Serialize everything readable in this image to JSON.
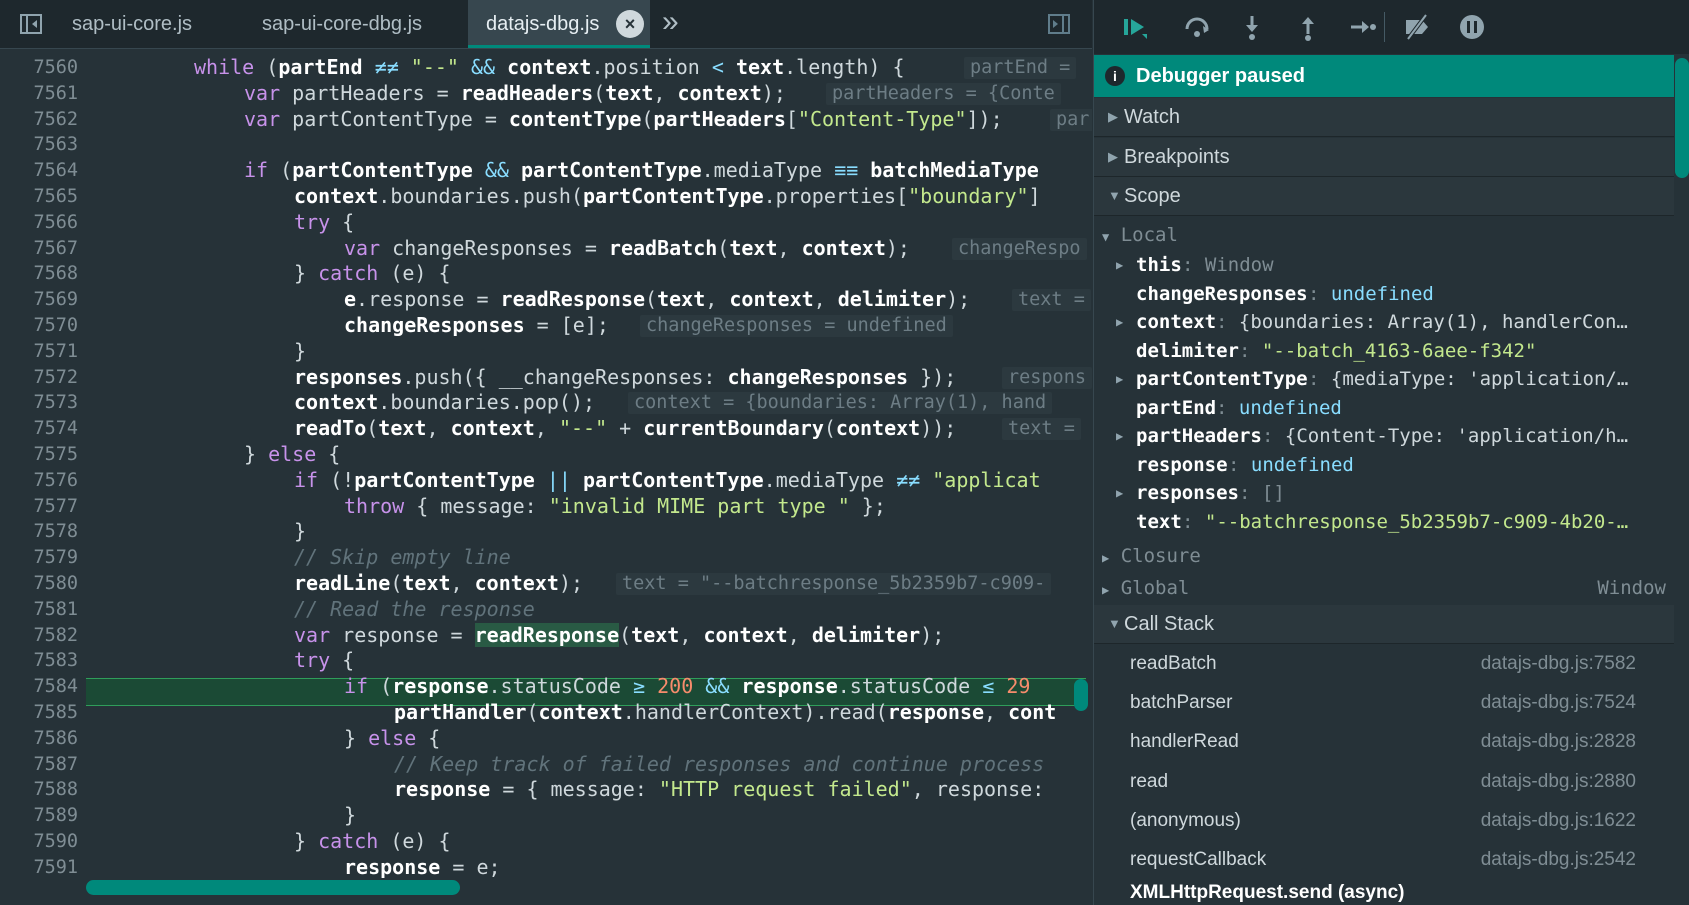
{
  "tabs": [
    "sap-ui-core.js",
    "sap-ui-core-dbg.js",
    "datajs-dbg.js"
  ],
  "active_tab_close": "×",
  "more_tabs": "»",
  "code_lines": [
    {
      "n": "7560"
    },
    {
      "n": "7561"
    },
    {
      "n": "7562"
    },
    {
      "n": "7563"
    },
    {
      "n": "7564"
    },
    {
      "n": "7565"
    },
    {
      "n": "7566"
    },
    {
      "n": "7567"
    },
    {
      "n": "7568"
    },
    {
      "n": "7569"
    },
    {
      "n": "7570"
    },
    {
      "n": "7571"
    },
    {
      "n": "7572"
    },
    {
      "n": "7573"
    },
    {
      "n": "7574"
    },
    {
      "n": "7575"
    },
    {
      "n": "7576"
    },
    {
      "n": "7577"
    },
    {
      "n": "7578"
    },
    {
      "n": "7579"
    },
    {
      "n": "7580"
    },
    {
      "n": "7581"
    },
    {
      "n": "7582"
    },
    {
      "n": "7583"
    },
    {
      "n": "7584"
    },
    {
      "n": "7585"
    },
    {
      "n": "7586"
    },
    {
      "n": "7587"
    },
    {
      "n": "7588"
    },
    {
      "n": "7589"
    },
    {
      "n": "7590"
    },
    {
      "n": "7591"
    }
  ],
  "inline_values": {
    "l7560": "partEnd =",
    "l7561": "partHeaders = {Conte",
    "l7562": "par",
    "l7567": "changeRespo",
    "l7569": "text =",
    "l7570": "changeResponses = undefined",
    "l7572": "respons",
    "l7573": "context = {boundaries: Array(1), hand",
    "l7574": "text =",
    "l7580": "text = \"--batchresponse_5b2359b7-c909-"
  },
  "debugger": {
    "status": "Debugger paused",
    "sections": {
      "watch": "Watch",
      "breakpoints": "Breakpoints",
      "scope": "Scope",
      "call_stack": "Call Stack"
    },
    "scope": {
      "local_label": "Local",
      "rows": [
        {
          "name": "this",
          "sep": ": ",
          "value": "Window",
          "kind": "dim",
          "expandable": true
        },
        {
          "name": "changeResponses",
          "sep": ": ",
          "value": "undefined",
          "kind": "undef",
          "expandable": false
        },
        {
          "name": "context",
          "sep": ": ",
          "value": "{boundaries: Array(1), handlerCon…",
          "kind": "obj",
          "expandable": true
        },
        {
          "name": "delimiter",
          "sep": ": ",
          "value": "\"--batch_4163-6aee-f342\"",
          "kind": "str",
          "expandable": false
        },
        {
          "name": "partContentType",
          "sep": ": ",
          "value": "{mediaType: 'application/…",
          "kind": "obj",
          "expandable": true
        },
        {
          "name": "partEnd",
          "sep": ": ",
          "value": "undefined",
          "kind": "undef",
          "expandable": false
        },
        {
          "name": "partHeaders",
          "sep": ": ",
          "value": "{Content-Type: 'application/h…",
          "kind": "obj",
          "expandable": true
        },
        {
          "name": "response",
          "sep": ": ",
          "value": "undefined",
          "kind": "undef",
          "expandable": false
        },
        {
          "name": "responses",
          "sep": ": ",
          "value": "[]",
          "kind": "dim",
          "expandable": true
        },
        {
          "name": "text",
          "sep": ": ",
          "value": "\"--batchresponse_5b2359b7-c909-4b20-…",
          "kind": "str",
          "expandable": false
        }
      ],
      "closure_label": "Closure",
      "global_label": "Global",
      "global_value": "Window"
    },
    "call_stack": [
      {
        "fn": "readBatch",
        "loc": "datajs-dbg.js:7582"
      },
      {
        "fn": "batchParser",
        "loc": "datajs-dbg.js:7524"
      },
      {
        "fn": "handlerRead",
        "loc": "datajs-dbg.js:2828"
      },
      {
        "fn": "read",
        "loc": "datajs-dbg.js:2880"
      },
      {
        "fn": "(anonymous)",
        "loc": "datajs-dbg.js:1622"
      },
      {
        "fn": "requestCallback",
        "loc": "datajs-dbg.js:2542"
      }
    ],
    "async_label": "XMLHttpRequest.send (async)"
  },
  "colors": {
    "accent": "#00897b",
    "bg": "#263238",
    "keyword": "#c792ea",
    "string": "#c3e88d",
    "number": "#f78c6c",
    "exec_line": "#1b4a35"
  }
}
